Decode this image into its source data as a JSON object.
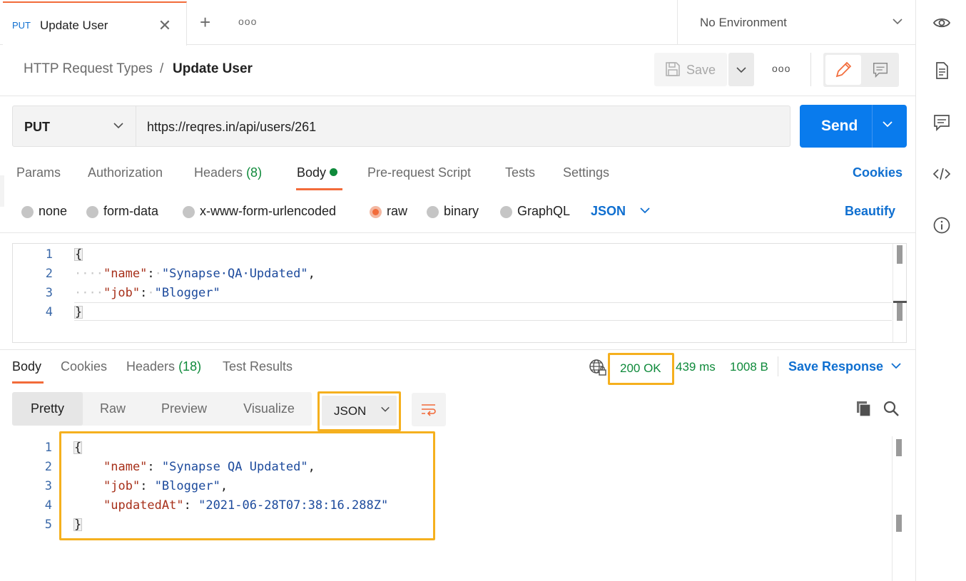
{
  "tabbar": {
    "active_tab": {
      "method": "PUT",
      "title": "Update User",
      "close_glyph": "✕"
    },
    "new_tab_glyph": "+",
    "more_glyph": "ooo",
    "environment": "No Environment"
  },
  "breadcrumb": {
    "parent": "HTTP Request Types",
    "separator": "/",
    "current": "Update User"
  },
  "toolbar": {
    "save_label": "Save",
    "more_glyph": "ooo"
  },
  "request": {
    "method": "PUT",
    "url": "https://reqres.in/api/users/261",
    "send_label": "Send"
  },
  "request_tabs": {
    "params": "Params",
    "authorization": "Authorization",
    "headers": "Headers",
    "headers_count": "(8)",
    "body": "Body",
    "pre_request": "Pre-request Script",
    "tests": "Tests",
    "settings": "Settings",
    "cookies": "Cookies"
  },
  "body_types": {
    "none": "none",
    "form_data": "form-data",
    "urlencoded": "x-www-form-urlencoded",
    "raw": "raw",
    "binary": "binary",
    "graphql": "GraphQL",
    "selected": "raw",
    "language": "JSON",
    "beautify": "Beautify"
  },
  "request_body": {
    "line_numbers": [
      "1",
      "2",
      "3",
      "4"
    ],
    "lines": {
      "l1_open": "{",
      "l2_indent": "····",
      "l2_key": "\"name\"",
      "l2_colon": ":",
      "l2_sp": "·",
      "l2_value": "\"Synapse·QA·Updated\"",
      "l2_comma": ",",
      "l3_indent": "····",
      "l3_key": "\"job\"",
      "l3_colon": ":",
      "l3_sp": "·",
      "l3_value": "\"Blogger\"",
      "l4_close": "}"
    }
  },
  "response_tabs": {
    "body": "Body",
    "cookies": "Cookies",
    "headers": "Headers",
    "headers_count": "(18)",
    "test_results": "Test Results"
  },
  "response_meta": {
    "status": "200 OK",
    "time": "439 ms",
    "size": "1008 B",
    "save_response": "Save Response"
  },
  "response_view": {
    "pretty": "Pretty",
    "raw": "Raw",
    "preview": "Preview",
    "visualize": "Visualize",
    "format": "JSON"
  },
  "response_body": {
    "line_numbers": [
      "1",
      "2",
      "3",
      "4",
      "5"
    ],
    "lines": {
      "l1_open": "{",
      "l2_key": "\"name\"",
      "l2_colon": ":",
      "l2_value": "\"Synapse QA Updated\"",
      "l2_comma": ",",
      "l3_key": "\"job\"",
      "l3_colon": ":",
      "l3_value": "\"Blogger\"",
      "l3_comma": ",",
      "l4_key": "\"updatedAt\"",
      "l4_colon": ":",
      "l4_value": "\"2021-06-28T07:38:16.288Z\"",
      "l5_close": "}"
    }
  },
  "colors": {
    "accent_orange": "#f26b3a",
    "send_blue": "#097bed",
    "link_blue": "#0f6fd0",
    "status_green": "#0f8a3b",
    "highlight_yellow": "#f5b01e",
    "json_key": "#a7301a",
    "json_string": "#1c4a9c"
  },
  "icons": {
    "right_rail": [
      "documentation-icon",
      "comments-icon",
      "code-icon",
      "info-icon"
    ],
    "top_right": "eye-icon"
  }
}
